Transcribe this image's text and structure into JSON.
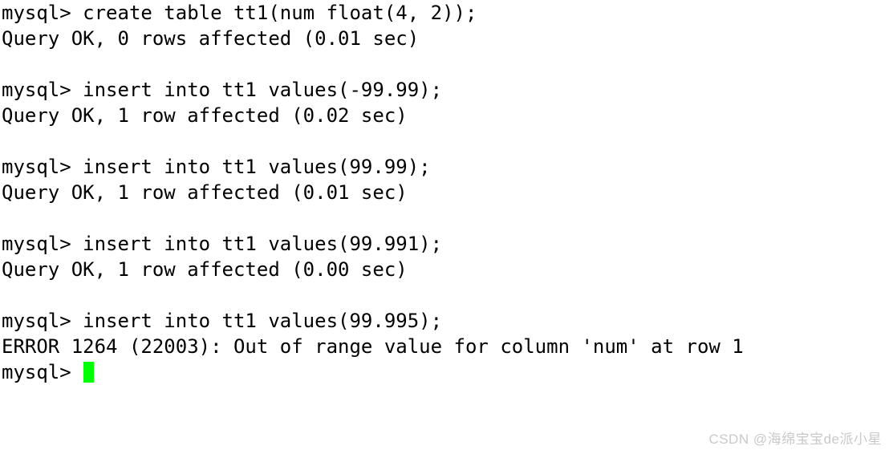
{
  "terminal": {
    "background_color": "#ffffff",
    "text_color": "#000000",
    "cursor_color": "#00ff00",
    "lines": [
      {
        "text": "mysql> create table tt1(num float(4, 2));",
        "type": "command"
      },
      {
        "text": "Query OK, 0 rows affected (0.01 sec)",
        "type": "result"
      },
      {
        "text": "",
        "type": "blank"
      },
      {
        "text": "mysql> insert into tt1 values(-99.99);",
        "type": "command"
      },
      {
        "text": "Query OK, 1 row affected (0.02 sec)",
        "type": "result"
      },
      {
        "text": "",
        "type": "blank"
      },
      {
        "text": "mysql> insert into tt1 values(99.99);",
        "type": "command"
      },
      {
        "text": "Query OK, 1 row affected (0.01 sec)",
        "type": "result"
      },
      {
        "text": "",
        "type": "blank"
      },
      {
        "text": "mysql> insert into tt1 values(99.991);",
        "type": "command"
      },
      {
        "text": "Query OK, 1 row affected (0.00 sec)",
        "type": "result"
      },
      {
        "text": "",
        "type": "blank"
      },
      {
        "text": "mysql> insert into tt1 values(99.995);",
        "type": "command"
      },
      {
        "text": "ERROR 1264 (22003): Out of range value for column 'num' at row 1",
        "type": "error"
      }
    ],
    "active_prompt": "mysql> "
  },
  "watermark": {
    "text": "CSDN @海绵宝宝de派小星",
    "color": "#c9c9c9"
  }
}
